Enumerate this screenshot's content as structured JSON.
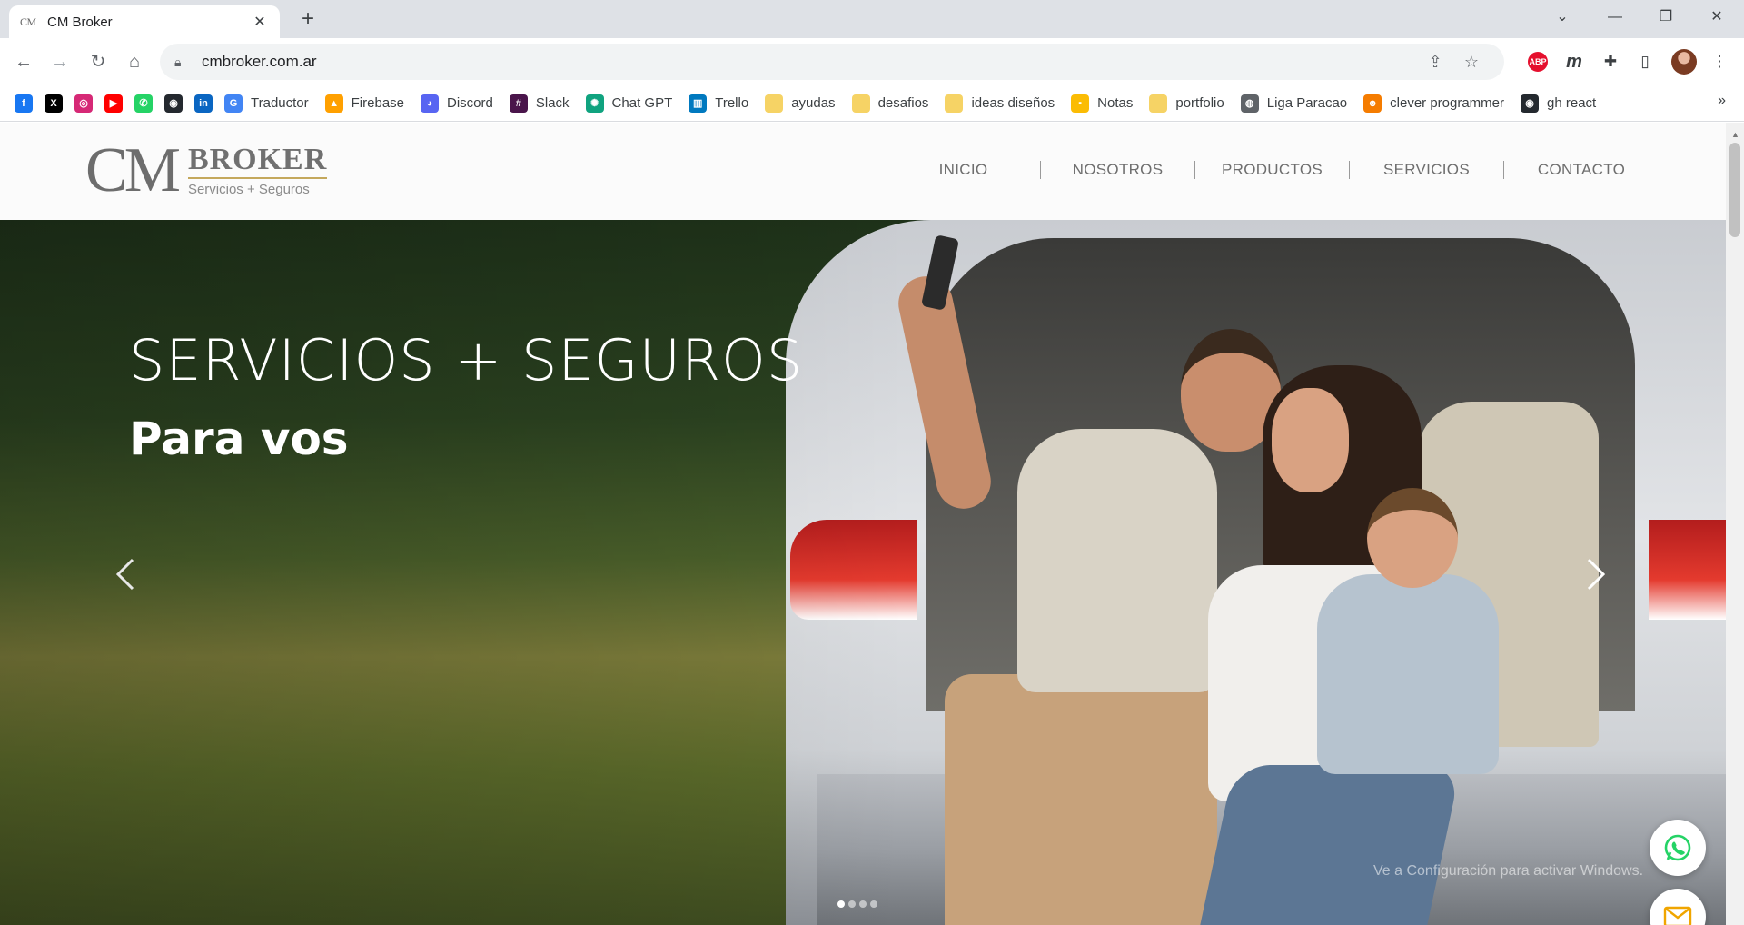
{
  "browser": {
    "tab": {
      "favicon_text": "CM",
      "title": "CM Broker"
    },
    "url": "cmbroker.com.ar",
    "bookmarks": [
      {
        "label": "",
        "icon": "facebook-icon",
        "color": "#1877f2",
        "glyph": "f"
      },
      {
        "label": "",
        "icon": "x-icon",
        "color": "#000000",
        "glyph": "X"
      },
      {
        "label": "",
        "icon": "instagram-icon",
        "color": "#d62976",
        "glyph": "◎"
      },
      {
        "label": "",
        "icon": "youtube-icon",
        "color": "#ff0000",
        "glyph": "▶"
      },
      {
        "label": "",
        "icon": "whatsapp-icon",
        "color": "#25d366",
        "glyph": "✆"
      },
      {
        "label": "",
        "icon": "github-icon",
        "color": "#24292f",
        "glyph": "◉"
      },
      {
        "label": "",
        "icon": "linkedin-icon",
        "color": "#0a66c2",
        "glyph": "in"
      },
      {
        "label": "Traductor",
        "icon": "google-icon",
        "color": "#4285f4",
        "glyph": "G"
      },
      {
        "label": "Firebase",
        "icon": "firebase-icon",
        "color": "#ffa000",
        "glyph": "▲"
      },
      {
        "label": "Discord",
        "icon": "discord-icon",
        "color": "#5865f2",
        "glyph": "◕"
      },
      {
        "label": "Slack",
        "icon": "slack-icon",
        "color": "#4a154b",
        "glyph": "#"
      },
      {
        "label": "Chat GPT",
        "icon": "chatgpt-icon",
        "color": "#10a37f",
        "glyph": "✺"
      },
      {
        "label": "Trello",
        "icon": "trello-icon",
        "color": "#0079bf",
        "glyph": "▥"
      },
      {
        "label": "ayudas",
        "icon": "folder-icon",
        "color": "#f6d365",
        "glyph": ""
      },
      {
        "label": "desafios",
        "icon": "folder-icon",
        "color": "#f6d365",
        "glyph": ""
      },
      {
        "label": "ideas diseños",
        "icon": "folder-icon",
        "color": "#f6d365",
        "glyph": ""
      },
      {
        "label": "Notas",
        "icon": "notes-icon",
        "color": "#fbbc04",
        "glyph": "▪"
      },
      {
        "label": "portfolio",
        "icon": "folder-icon",
        "color": "#f6d365",
        "glyph": ""
      },
      {
        "label": "Liga Paracao",
        "icon": "globe-icon",
        "color": "#5f6368",
        "glyph": "◍"
      },
      {
        "label": "clever programmer",
        "icon": "clever-icon",
        "color": "#f57c00",
        "glyph": "☻"
      },
      {
        "label": "gh react",
        "icon": "github-icon",
        "color": "#24292f",
        "glyph": "◉"
      }
    ]
  },
  "site": {
    "logo": {
      "cm": "CM",
      "broker": "BROKER",
      "tagline": "Servicios + Seguros"
    },
    "nav": [
      "INICIO",
      "NOSOTROS",
      "PRODUCTOS",
      "SERVICIOS",
      "CONTACTO"
    ],
    "hero": {
      "title": "SERVICIOS + SEGUROS",
      "subtitle": "Para vos",
      "slide_count": 4,
      "active_slide": 1
    },
    "watermark": "Ve a Configuración para activar Windows."
  },
  "colors": {
    "accent_gold": "#c4a85c",
    "nav_text": "#6e6e6e",
    "whatsapp": "#25d366",
    "mail": "#f0a500"
  }
}
